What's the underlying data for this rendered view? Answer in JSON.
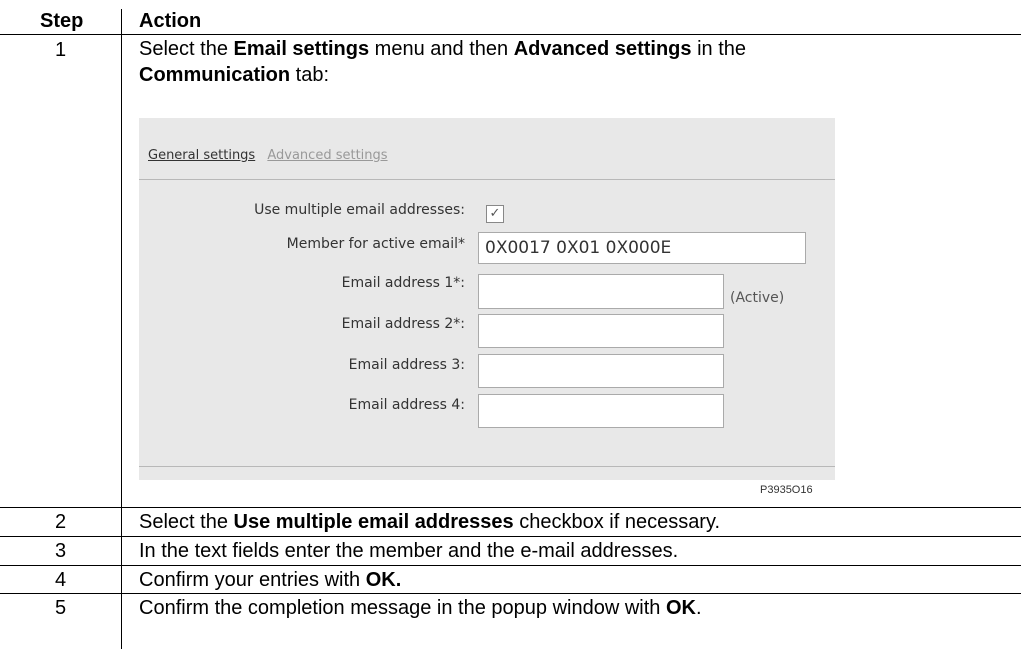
{
  "table": {
    "header_step": "Step",
    "header_action": "Action",
    "rows": [
      {
        "step": "1",
        "line1_a": "Select the ",
        "line1_b": "Email settings",
        "line1_c": " menu and then ",
        "line1_d": "Advanced settings",
        "line1_e": " in the",
        "line2_a": "Communication",
        "line2_b": " tab:"
      },
      {
        "step": "2",
        "a": "Select the ",
        "b": "Use multiple email addresses",
        "c": " checkbox if necessary."
      },
      {
        "step": "3",
        "a": "In the text fields enter the member and the e-mail addresses."
      },
      {
        "step": "4",
        "a": "Confirm your entries with ",
        "b": "OK."
      },
      {
        "step": "5",
        "a": "Confirm the completion message in the popup window with ",
        "b": "OK",
        "c": "."
      }
    ]
  },
  "screenshot": {
    "tab_general": "General settings",
    "tab_advanced": "Advanced settings",
    "label_multiple": "Use multiple email addresses:",
    "checkbox_mark": "✓",
    "label_member": "Member for active email*",
    "member_value": "0X0017 0X01 0X000E",
    "label_email1": "Email address 1*:",
    "label_email2": "Email address 2*:",
    "label_email3": "Email address 3:",
    "label_email4": "Email address 4:",
    "active_note": "(Active)"
  },
  "figure_id": "P3935O16"
}
